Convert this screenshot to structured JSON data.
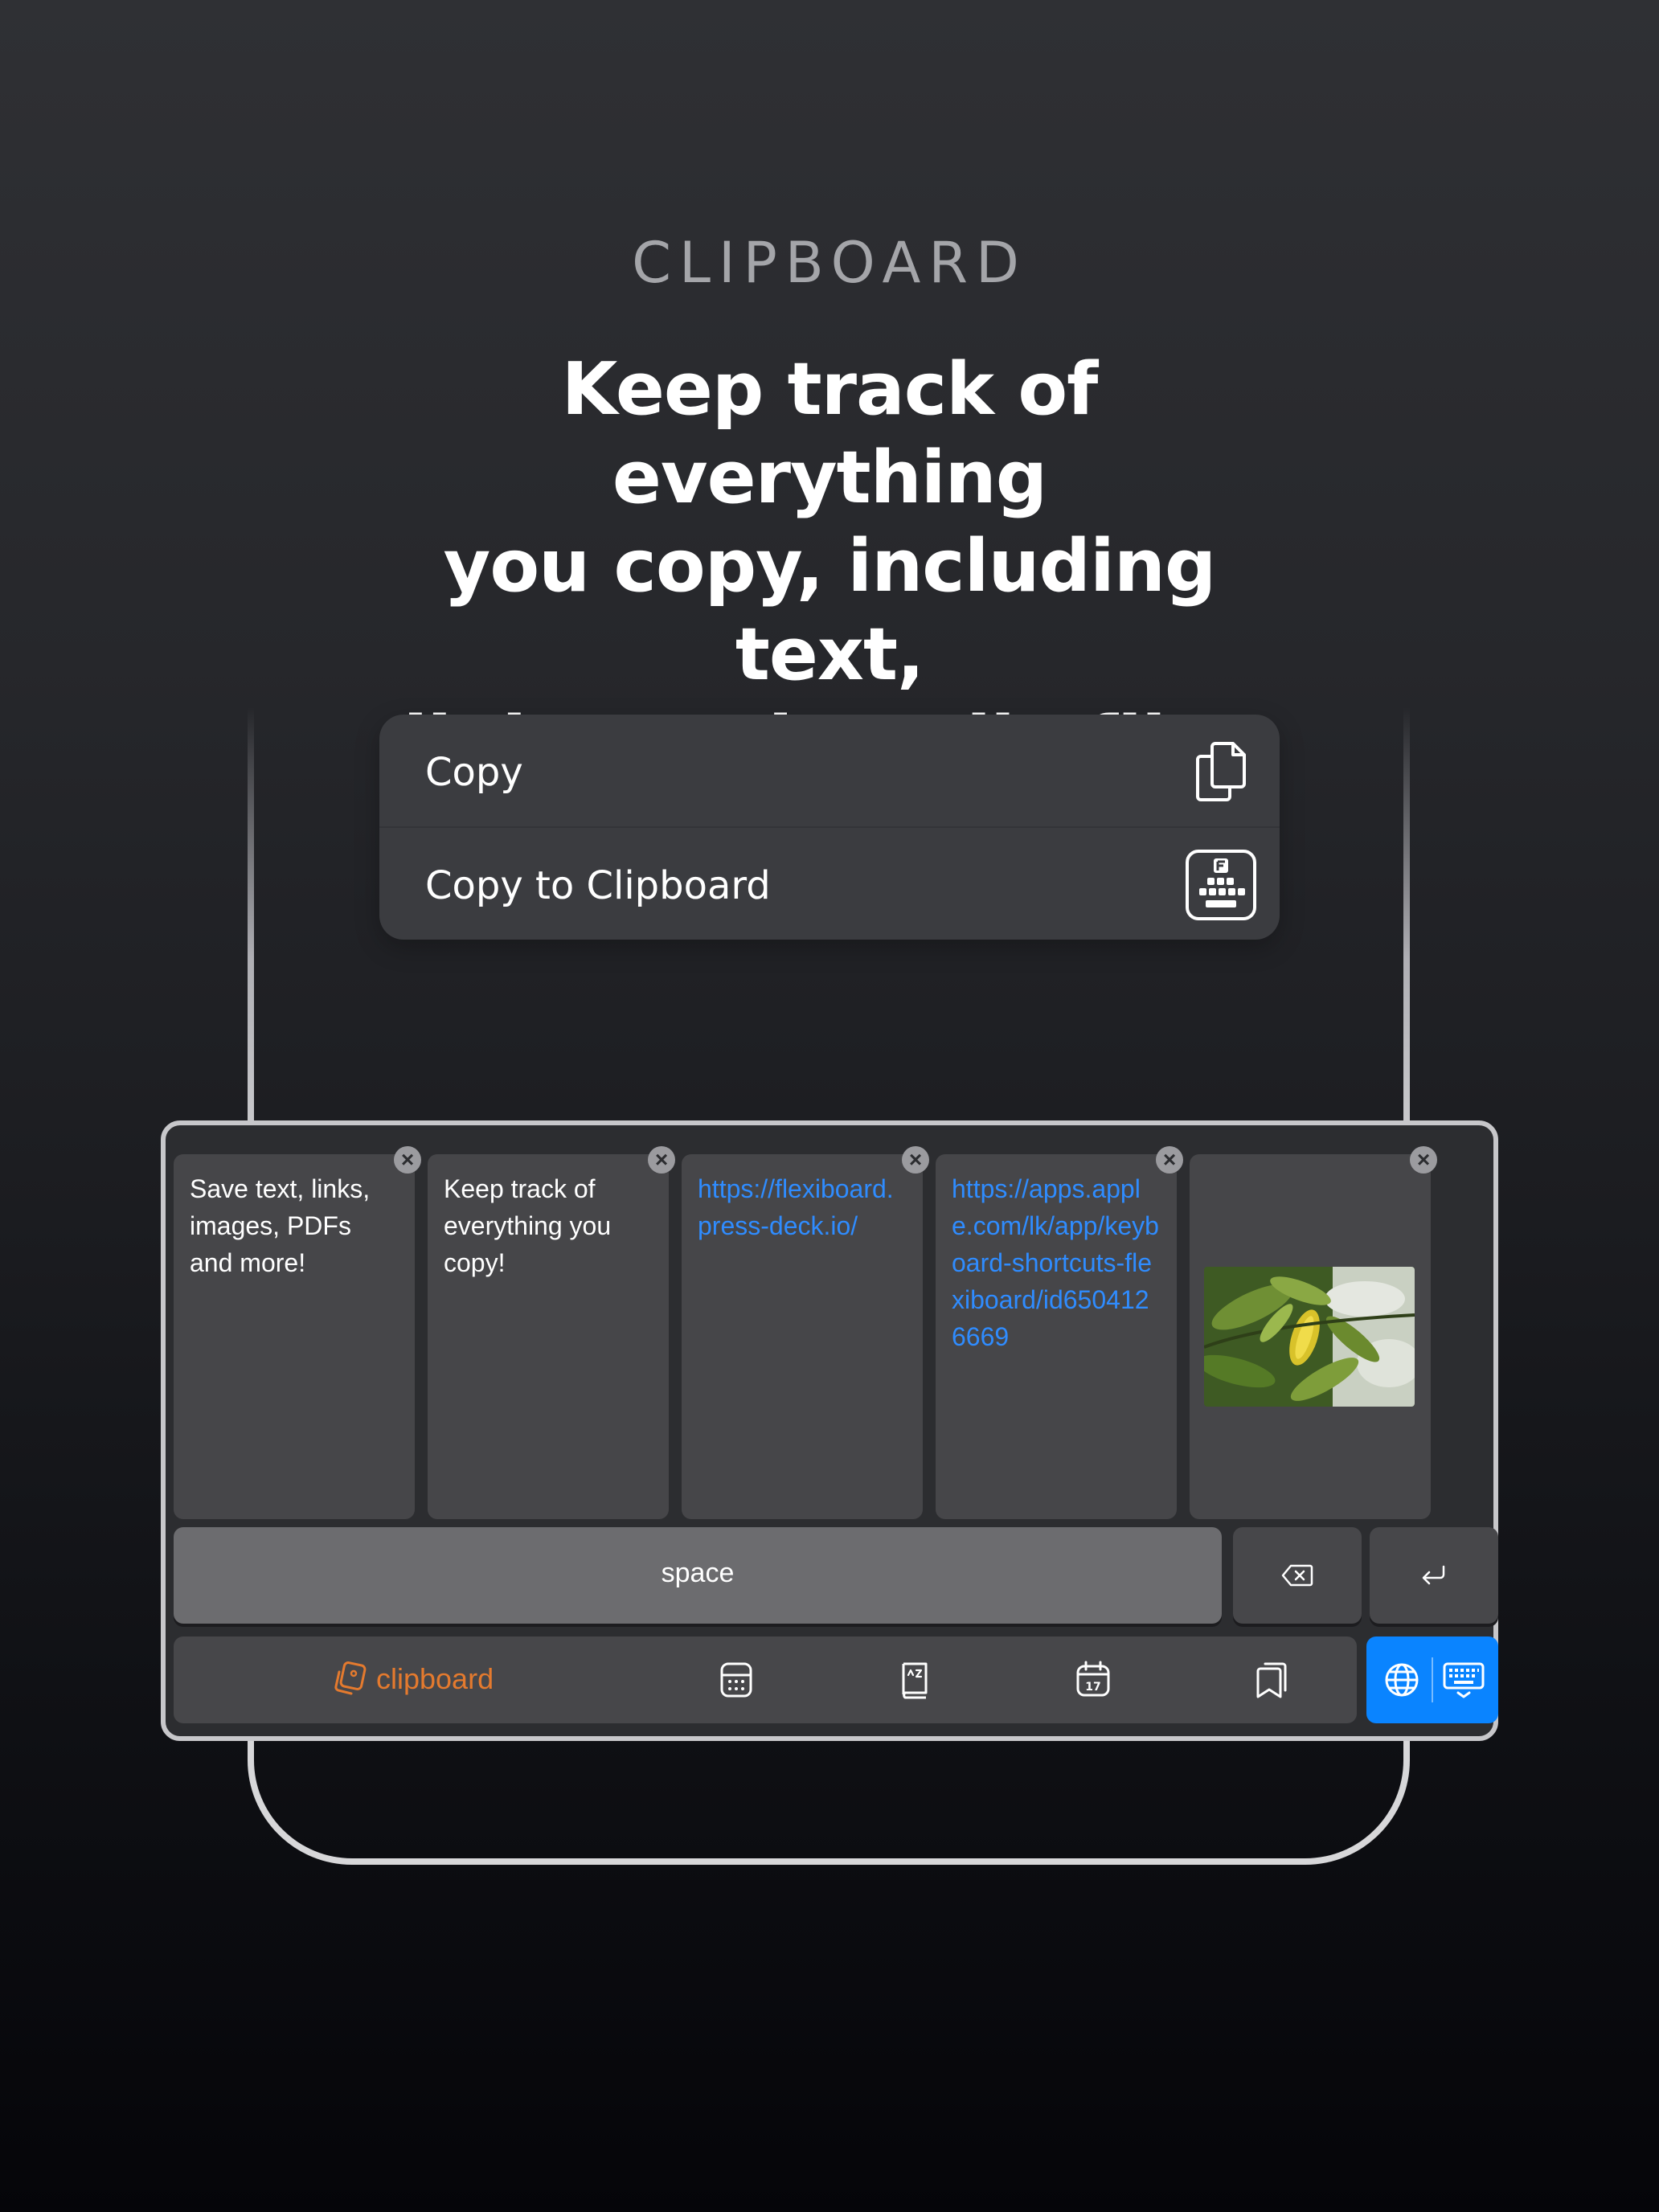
{
  "header": {
    "eyebrow": "CLIPBOARD",
    "headline_lines": [
      "Keep track of everything",
      "you copy, including text,",
      "links, and media files"
    ]
  },
  "context_menu": {
    "items": [
      {
        "label": "Copy",
        "icon": "copy-documents-icon"
      },
      {
        "label": "Copy to Clipboard",
        "icon": "flexiboard-keyboard-icon"
      }
    ]
  },
  "clipboard": {
    "items": [
      {
        "type": "text",
        "text": "Save text, links, images, PDFs and more!"
      },
      {
        "type": "text",
        "text": "Keep track of everything you copy!"
      },
      {
        "type": "link",
        "text": "https://flexiboard.press-deck.io/"
      },
      {
        "type": "link",
        "text": "https://apps.apple.com/lk/app/keyboard-shortcuts-flexiboard/id6504126669"
      },
      {
        "type": "image",
        "icon": "leaf-photo-thumbnail"
      }
    ]
  },
  "keys": {
    "space_label": "space",
    "backspace_icon": "backspace-icon",
    "return_icon": "return-icon"
  },
  "toolbar": {
    "clipboard_label": "clipboard",
    "icons": [
      "calculator-icon",
      "dictionary-icon",
      "calendar-icon",
      "bookmarks-icon"
    ],
    "switcher_icons": [
      "globe-icon",
      "keyboard-hide-icon"
    ]
  },
  "colors": {
    "accent_orange": "#e47a2e",
    "link_blue": "#2f8cff",
    "switcher_blue": "#0a84ff",
    "card_bg": "#464649",
    "menu_bg": "#3b3c40"
  }
}
